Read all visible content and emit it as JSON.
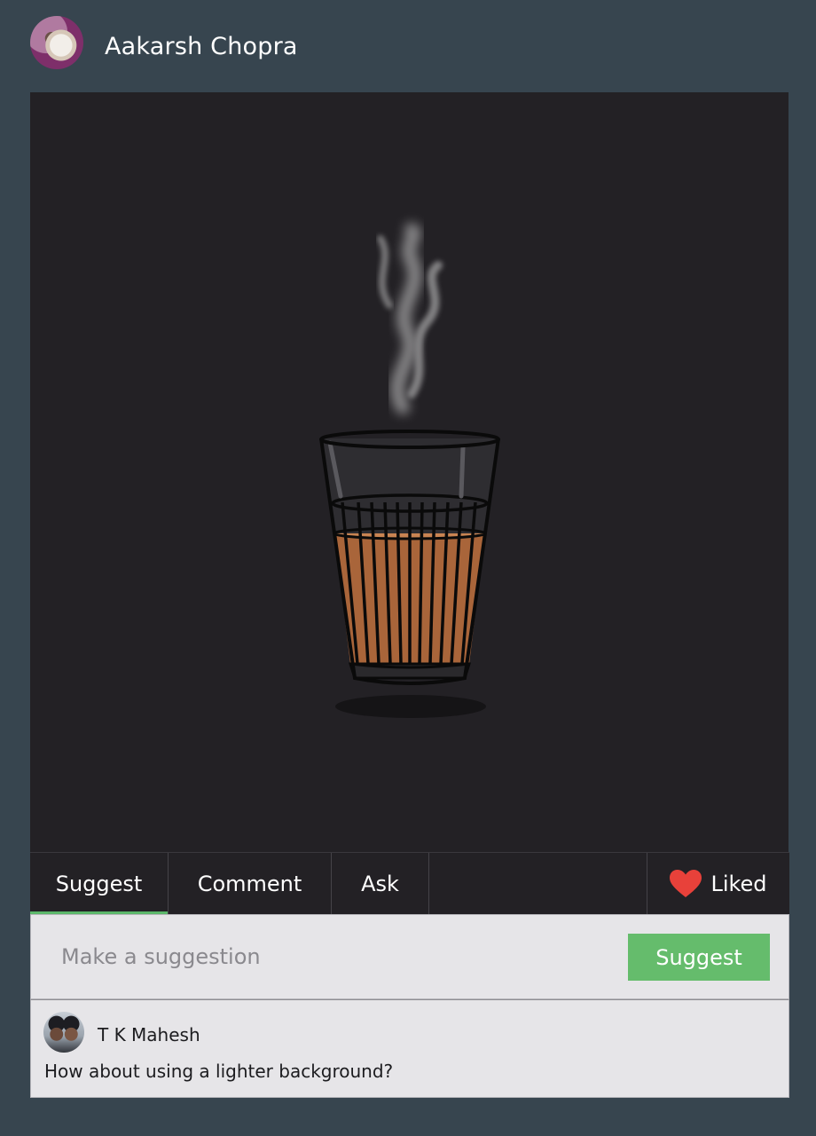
{
  "post": {
    "author": "Aakarsh Chopra",
    "image_desc": "chai-glass"
  },
  "tabs": {
    "suggest": "Suggest",
    "comment": "Comment",
    "ask": "Ask",
    "liked": "Liked",
    "active": "Suggest"
  },
  "suggestion": {
    "placeholder": "Make a suggestion",
    "value": "",
    "button_label": "Suggest"
  },
  "comments": [
    {
      "author": "T K Mahesh",
      "text": "How about using a lighter background?"
    }
  ],
  "colors": {
    "page_bg": "#37454f",
    "image_bg": "#232125",
    "accent_green": "#65bc6c",
    "heart_red": "#e8413a",
    "tea": "#a9653a"
  },
  "icons": {
    "liked": "heart-icon"
  }
}
